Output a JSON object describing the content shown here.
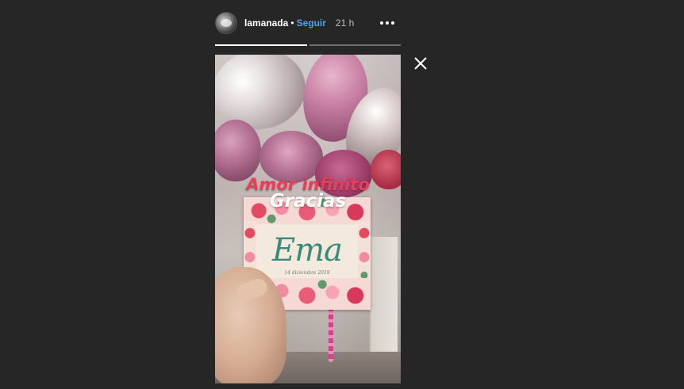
{
  "header": {
    "username": "lamanada",
    "separator": "•",
    "follow_label": "Seguir",
    "time": "21 h",
    "more_icon": "more-horizontal-icon",
    "avatar_icon": "profile-avatar"
  },
  "progress": {
    "segments": 2,
    "current_fill": 1.0,
    "second_fill": 0.0
  },
  "close_icon": "close-icon",
  "story": {
    "sticker_line1": "Amor infinito",
    "sticker_line2": "Gracias",
    "card_name": "Ema",
    "card_date": "14 diciembre 2019"
  },
  "colors": {
    "background": "#262626",
    "follow": "#4aa3f5",
    "sticker_pink": "#e83f59",
    "card_teal": "#3a8a7b"
  }
}
